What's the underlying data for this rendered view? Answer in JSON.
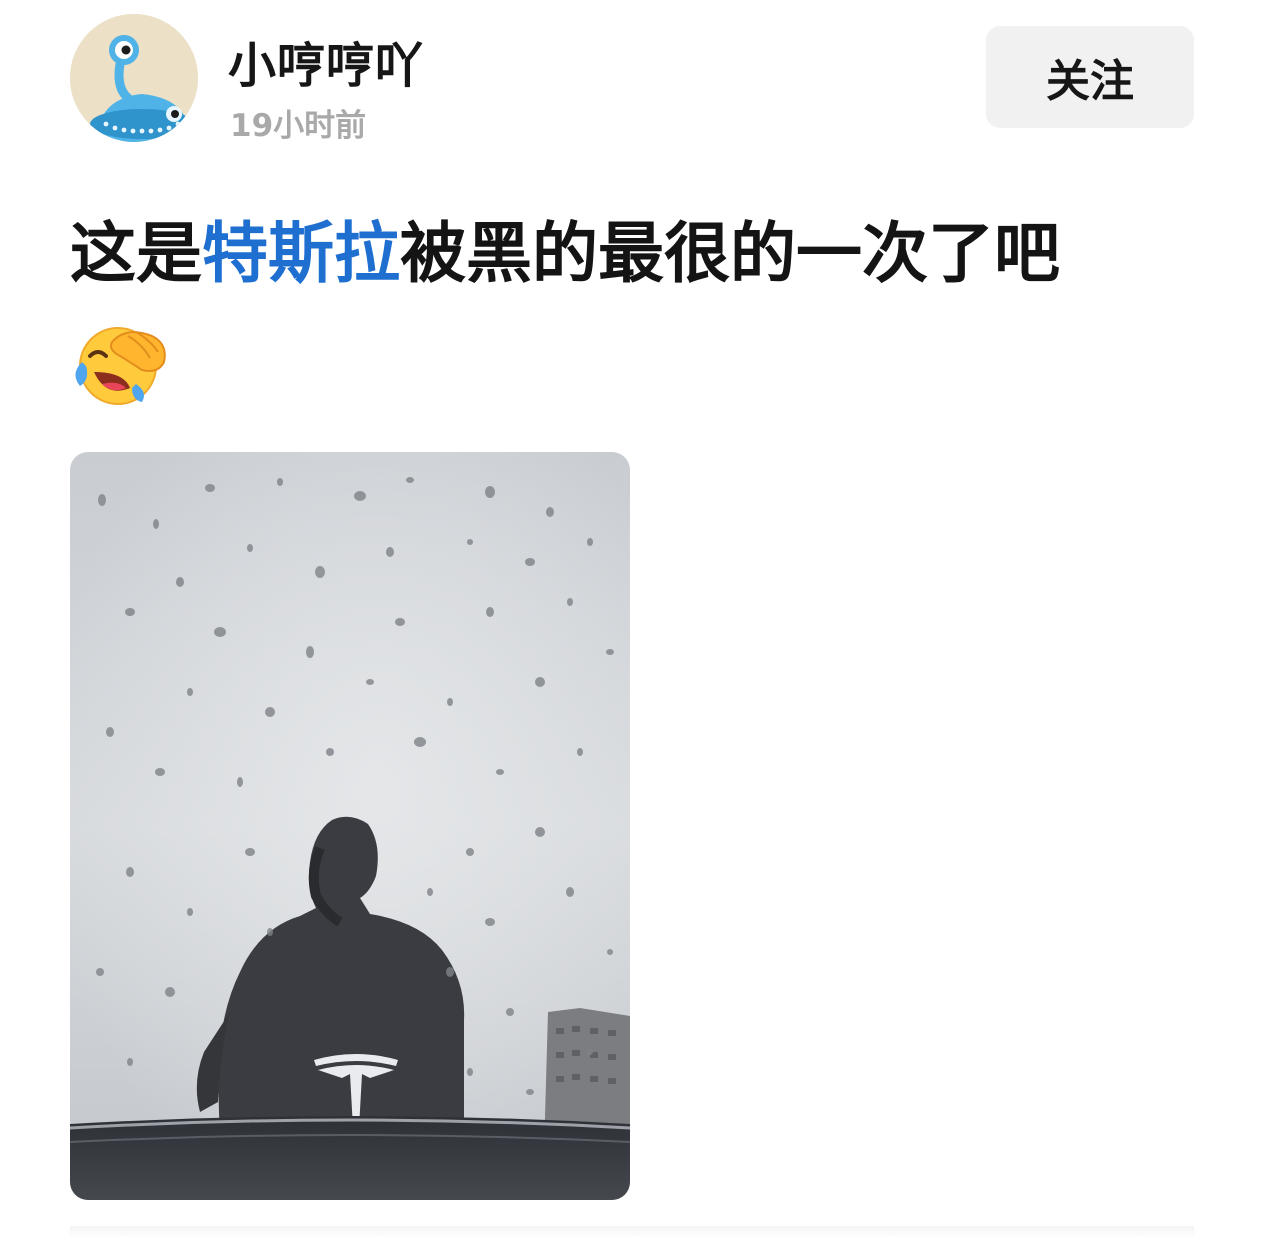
{
  "author": {
    "name": "小哼哼吖",
    "time": "19小时前",
    "avatar_icon": "alien-avatar-icon"
  },
  "follow_label": "关注",
  "post": {
    "text_before": "这是",
    "topic": "特斯拉",
    "text_after": "被黑的最很的一次了吧",
    "emoji_icon": "laughing-crying-facepalm-emoji",
    "photo_icon": "tesla-hood-reflection-photo"
  },
  "colors": {
    "topic_link": "#1f6fd1",
    "follow_bg": "#f1f1f1",
    "time_gray": "#a9a9a9",
    "avatar_bg": "#ece0c6",
    "avatar_alien": "#4fb3e8"
  }
}
